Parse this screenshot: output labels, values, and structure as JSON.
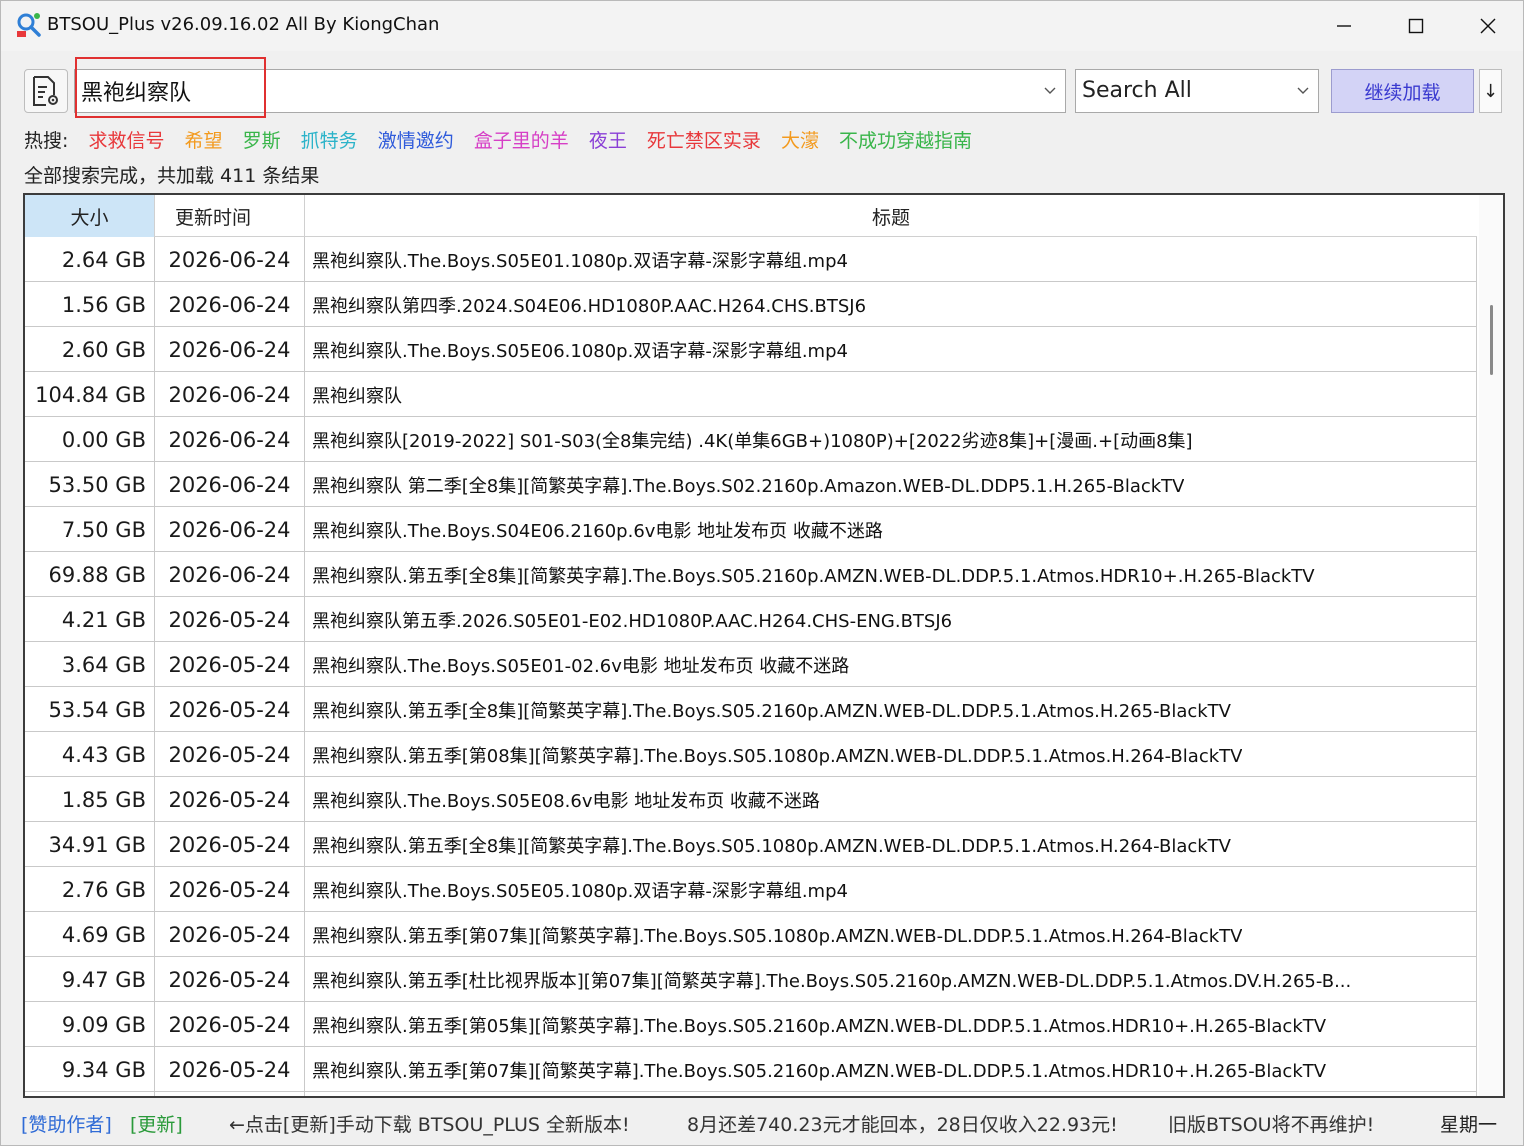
{
  "window": {
    "title": "BTSOU_Plus v26.09.16.02 All By KiongChan"
  },
  "toolbar": {
    "search_value": "黑袍纠察队",
    "scope_label": "Search All",
    "load_button": "继续加载",
    "down_button": "↓"
  },
  "hot": {
    "label": "热搜:",
    "items": [
      {
        "text": "求救信号",
        "color": "#e8383b"
      },
      {
        "text": "希望",
        "color": "#f39a1e"
      },
      {
        "text": "罗斯",
        "color": "#39b54a"
      },
      {
        "text": "抓特务",
        "color": "#2bb3c9"
      },
      {
        "text": "激情邀约",
        "color": "#2f5bdb"
      },
      {
        "text": "盒子里的羊",
        "color": "#d63fc6"
      },
      {
        "text": "夜王",
        "color": "#8a3fd6"
      },
      {
        "text": "死亡禁区实录",
        "color": "#e8383b"
      },
      {
        "text": "大濛",
        "color": "#f39a1e"
      },
      {
        "text": "不成功穿越指南",
        "color": "#39b54a"
      }
    ]
  },
  "status_line": "全部搜索完成，共加载 411 条结果",
  "table": {
    "headers": {
      "size": "大小",
      "time": "更新时间",
      "title": "标题"
    },
    "rows": [
      {
        "size": "2.64 GB",
        "time": "2026-06-24",
        "title": "黑袍纠察队.The.Boys.S05E01.1080p.双语字幕-深影字幕组.mp4"
      },
      {
        "size": "1.56 GB",
        "time": "2026-06-24",
        "title": "黑袍纠察队第四季.2024.S04E06.HD1080P.AAC.H264.CHS.BTSJ6"
      },
      {
        "size": "2.60 GB",
        "time": "2026-06-24",
        "title": "黑袍纠察队.The.Boys.S05E06.1080p.双语字幕-深影字幕组.mp4"
      },
      {
        "size": "104.84 GB",
        "time": "2026-06-24",
        "title": "黑袍纠察队"
      },
      {
        "size": "0.00 GB",
        "time": "2026-06-24",
        "title": "黑袍纠察队[2019-2022] S01-S03(全8集完结) .4K(单集6GB+)1080P)+[2022劣迹8集]+[漫画.+[动画8集]"
      },
      {
        "size": "53.50 GB",
        "time": "2026-06-24",
        "title": "黑袍纠察队 第二季[全8集][简繁英字幕].The.Boys.S02.2160p.Amazon.WEB-DL.DDP5.1.H.265-BlackTV"
      },
      {
        "size": "7.50 GB",
        "time": "2026-06-24",
        "title": "黑袍纠察队.The.Boys.S04E06.2160p.6v电影 地址发布页 收藏不迷路"
      },
      {
        "size": "69.88 GB",
        "time": "2026-06-24",
        "title": "黑袍纠察队.第五季[全8集][简繁英字幕].The.Boys.S05.2160p.AMZN.WEB-DL.DDP.5.1.Atmos.HDR10+.H.265-BlackTV"
      },
      {
        "size": "4.21 GB",
        "time": "2026-05-24",
        "title": "黑袍纠察队第五季.2026.S05E01-E02.HD1080P.AAC.H264.CHS-ENG.BTSJ6"
      },
      {
        "size": "3.64 GB",
        "time": "2026-05-24",
        "title": "黑袍纠察队.The.Boys.S05E01-02.6v电影 地址发布页 收藏不迷路"
      },
      {
        "size": "53.54 GB",
        "time": "2026-05-24",
        "title": "黑袍纠察队.第五季[全8集][简繁英字幕].The.Boys.S05.2160p.AMZN.WEB-DL.DDP.5.1.Atmos.H.265-BlackTV"
      },
      {
        "size": "4.43 GB",
        "time": "2026-05-24",
        "title": "黑袍纠察队.第五季[第08集][简繁英字幕].The.Boys.S05.1080p.AMZN.WEB-DL.DDP.5.1.Atmos.H.264-BlackTV"
      },
      {
        "size": "1.85 GB",
        "time": "2026-05-24",
        "title": "黑袍纠察队.The.Boys.S05E08.6v电影 地址发布页 收藏不迷路"
      },
      {
        "size": "34.91 GB",
        "time": "2026-05-24",
        "title": "黑袍纠察队.第五季[全8集][简繁英字幕].The.Boys.S05.1080p.AMZN.WEB-DL.DDP.5.1.Atmos.H.264-BlackTV"
      },
      {
        "size": "2.76 GB",
        "time": "2026-05-24",
        "title": "黑袍纠察队.The.Boys.S05E05.1080p.双语字幕-深影字幕组.mp4"
      },
      {
        "size": "4.69 GB",
        "time": "2026-05-24",
        "title": "黑袍纠察队.第五季[第07集][简繁英字幕].The.Boys.S05.1080p.AMZN.WEB-DL.DDP.5.1.Atmos.H.264-BlackTV"
      },
      {
        "size": "9.47 GB",
        "time": "2026-05-24",
        "title": "黑袍纠察队.第五季[杜比视界版本][第07集][简繁英字幕].The.Boys.S05.2160p.AMZN.WEB-DL.DDP.5.1.Atmos.DV.H.265-B..."
      },
      {
        "size": "9.09 GB",
        "time": "2026-05-24",
        "title": "黑袍纠察队.第五季[第05集][简繁英字幕].The.Boys.S05.2160p.AMZN.WEB-DL.DDP.5.1.Atmos.HDR10+.H.265-BlackTV"
      },
      {
        "size": "9.34 GB",
        "time": "2026-05-24",
        "title": "黑袍纠察队.第五季[第07集][简繁英字幕].The.Boys.S05.2160p.AMZN.WEB-DL.DDP.5.1.Atmos.HDR10+.H.265-BlackTV"
      },
      {
        "size": "",
        "time": "",
        "title": ""
      }
    ]
  },
  "statusbar": {
    "sponsor": "[赞助作者]",
    "update": "[更新]",
    "hint": "←点击[更新]手动下载 BTSOU_PLUS 全新版本!",
    "funding": "8月还差740.23元才能回本，28日仅收入22.93元!",
    "legacy": "旧版BTSOU将不再维护!",
    "weekday": "星期一",
    "colors": {
      "link": "#2f6bd6",
      "update": "#2a9a3a"
    }
  }
}
